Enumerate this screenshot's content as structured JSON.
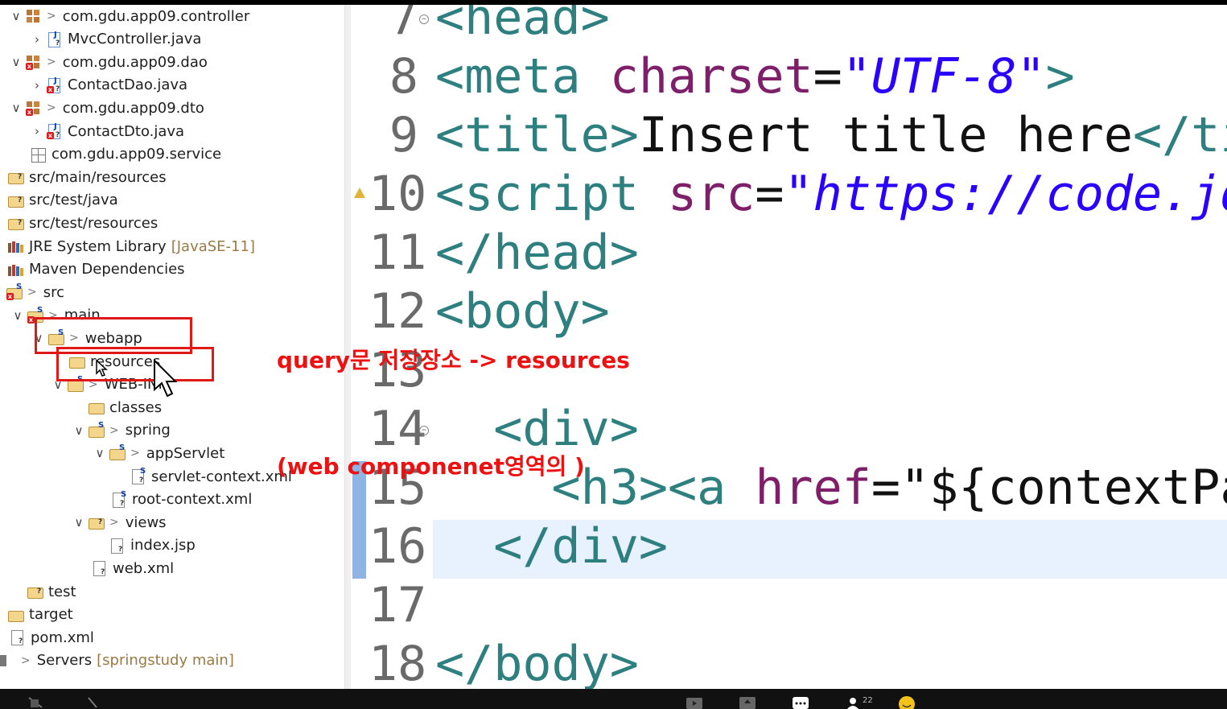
{
  "explorer": {
    "items": [
      {
        "twisty": "v",
        "decor": ">",
        "label": "com.gdu.app09.controller",
        "kind": "package"
      },
      {
        "twisty": ">",
        "decor": "",
        "label": "MvcController.java",
        "kind": "java"
      },
      {
        "twisty": "v",
        "decor": ">",
        "label": "com.gdu.app09.dao",
        "kind": "package-err"
      },
      {
        "twisty": ">",
        "decor": "",
        "label": "ContactDao.java",
        "kind": "java-err"
      },
      {
        "twisty": "v",
        "decor": ">",
        "label": "com.gdu.app09.dto",
        "kind": "package-err"
      },
      {
        "twisty": ">",
        "decor": "",
        "label": "ContactDto.java",
        "kind": "java-err"
      },
      {
        "twisty": "",
        "decor": "",
        "label": "com.gdu.app09.service",
        "kind": "package-empty"
      },
      {
        "twisty": "",
        "decor": "",
        "label": "src/main/resources",
        "kind": "srcfolder"
      },
      {
        "twisty": "",
        "decor": "",
        "label": "src/test/java",
        "kind": "srcfolder"
      },
      {
        "twisty": "",
        "decor": "",
        "label": "src/test/resources",
        "kind": "srcfolder"
      },
      {
        "twisty": "",
        "decor": "",
        "label": "JRE System Library",
        "hint": "[JavaSE-11]",
        "kind": "library"
      },
      {
        "twisty": "",
        "decor": "",
        "label": "Maven Dependencies",
        "kind": "library"
      },
      {
        "twisty": "",
        "decor": ">",
        "label": "src",
        "kind": "folder-err"
      },
      {
        "twisty": "v",
        "decor": ">",
        "label": "main",
        "kind": "folder-err"
      },
      {
        "twisty": "v",
        "decor": ">",
        "label": "webapp",
        "kind": "folder-s"
      },
      {
        "twisty": "",
        "decor": "",
        "label": "resources",
        "kind": "folder-open"
      },
      {
        "twisty": "v",
        "decor": ">",
        "label": "WEB-INF",
        "kind": "folder-s"
      },
      {
        "twisty": "",
        "decor": "",
        "label": "classes",
        "kind": "folder-open"
      },
      {
        "twisty": "v",
        "decor": ">",
        "label": "spring",
        "kind": "folder-s"
      },
      {
        "twisty": "v",
        "decor": ">",
        "label": "appServlet",
        "kind": "folder-s"
      },
      {
        "twisty": "",
        "decor": "",
        "label": "servlet-context.xml",
        "kind": "xml-s"
      },
      {
        "twisty": "",
        "decor": "",
        "label": "root-context.xml",
        "kind": "xml-s"
      },
      {
        "twisty": "v",
        "decor": ">",
        "label": "views",
        "kind": "folder-q"
      },
      {
        "twisty": "",
        "decor": "",
        "label": "index.jsp",
        "kind": "jsp"
      },
      {
        "twisty": "",
        "decor": "",
        "label": "web.xml",
        "kind": "xml"
      },
      {
        "twisty": "",
        "decor": "",
        "label": "test",
        "kind": "folder-q"
      },
      {
        "twisty": "",
        "decor": "",
        "label": "target",
        "kind": "folder-open"
      },
      {
        "twisty": "",
        "decor": "",
        "label": "pom.xml",
        "kind": "xml"
      },
      {
        "twisty": "",
        "decor": ">",
        "label": "Servers",
        "hint": "[springstudy main]",
        "kind": "servers"
      }
    ]
  },
  "editor": {
    "lines": [
      {
        "num": "7",
        "fold": true,
        "tokens": [
          {
            "t": "<head>",
            "c": "tg"
          }
        ]
      },
      {
        "num": "8",
        "tokens": [
          {
            "t": "<meta ",
            "c": "tg"
          },
          {
            "t": "charset",
            "c": "at"
          },
          {
            "t": "=",
            "c": "tx"
          },
          {
            "t": "\"UTF-8\"",
            "c": "st"
          },
          {
            "t": ">",
            "c": "tg"
          }
        ]
      },
      {
        "num": "9",
        "tokens": [
          {
            "t": "<title>",
            "c": "tg"
          },
          {
            "t": "Insert title here",
            "c": "tx"
          },
          {
            "t": "</title",
            "c": "tg"
          }
        ]
      },
      {
        "num": "10",
        "warn": true,
        "tokens": [
          {
            "t": "<script ",
            "c": "tg"
          },
          {
            "t": "src",
            "c": "at"
          },
          {
            "t": "=",
            "c": "tx"
          },
          {
            "t": "\"https://code.jquer",
            "c": "st"
          }
        ]
      },
      {
        "num": "11",
        "tokens": [
          {
            "t": "</head>",
            "c": "tg"
          }
        ]
      },
      {
        "num": "12",
        "tokens": [
          {
            "t": "<body>",
            "c": "tg"
          }
        ]
      },
      {
        "num": "13",
        "tokens": []
      },
      {
        "num": "14",
        "fold": true,
        "tokens": [
          {
            "t": "  <div>",
            "c": "tg"
          }
        ]
      },
      {
        "num": "15",
        "changed": true,
        "tokens": [
          {
            "t": "    <h3><a ",
            "c": "tg"
          },
          {
            "t": "href",
            "c": "at"
          },
          {
            "t": "=",
            "c": "tx"
          },
          {
            "t": "\"${contextPath}",
            "c": "tx"
          }
        ]
      },
      {
        "num": "16",
        "changed": true,
        "current": true,
        "tokens": [
          {
            "t": "  </div>",
            "c": "tg"
          }
        ]
      },
      {
        "num": "17",
        "tokens": []
      },
      {
        "num": "18",
        "tokens": [
          {
            "t": "</body>",
            "c": "tg"
          }
        ]
      }
    ]
  },
  "annotation": {
    "line1": "query문 저장장소 -> resources",
    "line2": "(web componenet영역의 )"
  },
  "taskbar": {
    "participants_count": "22"
  },
  "colors": {
    "tag": "#2e7f80",
    "attribute": "#7f1f6a",
    "string": "#2a00ff",
    "annotation": "#ee1111",
    "current_line": "#e8f2fe"
  }
}
